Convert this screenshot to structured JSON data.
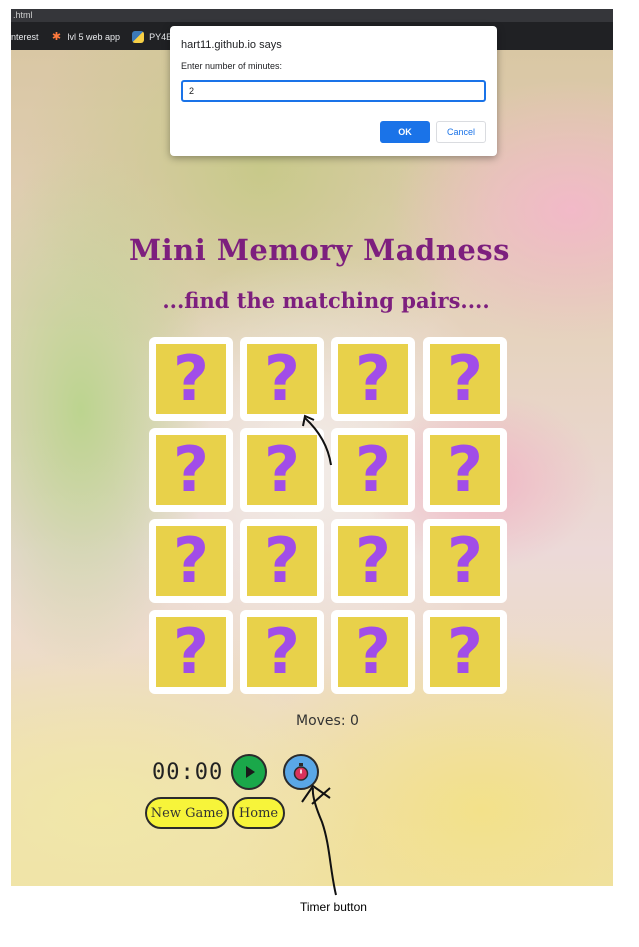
{
  "browser": {
    "tab_title": ".html",
    "bookmarks": [
      {
        "label": "nterest",
        "icon": "bookmark-icon"
      },
      {
        "label": "lvl 5 web app",
        "icon": "hubspot-icon"
      },
      {
        "label": "PY4E",
        "icon": "python-icon"
      }
    ]
  },
  "dialog": {
    "origin": "hart11.github.io says",
    "message": "Enter number of minutes:",
    "input_value": "2",
    "ok_label": "OK",
    "cancel_label": "Cancel",
    "ok_color": "#1a73e8"
  },
  "game": {
    "title": "Mini Memory Madness",
    "subtitle": "...find the matching pairs....",
    "card_symbol": "?",
    "card_count": 16,
    "card_face_color": "#e8d14a",
    "card_symbol_color": "#a14de8",
    "title_color": "#7d1f7e",
    "moves_label": "Moves: 0",
    "timer_display": "00:00",
    "play_icon": "play-icon",
    "timer_icon": "stopwatch-icon",
    "new_game_label": "New Game",
    "home_label": "Home"
  },
  "annotation": {
    "caption": "Timer button"
  }
}
